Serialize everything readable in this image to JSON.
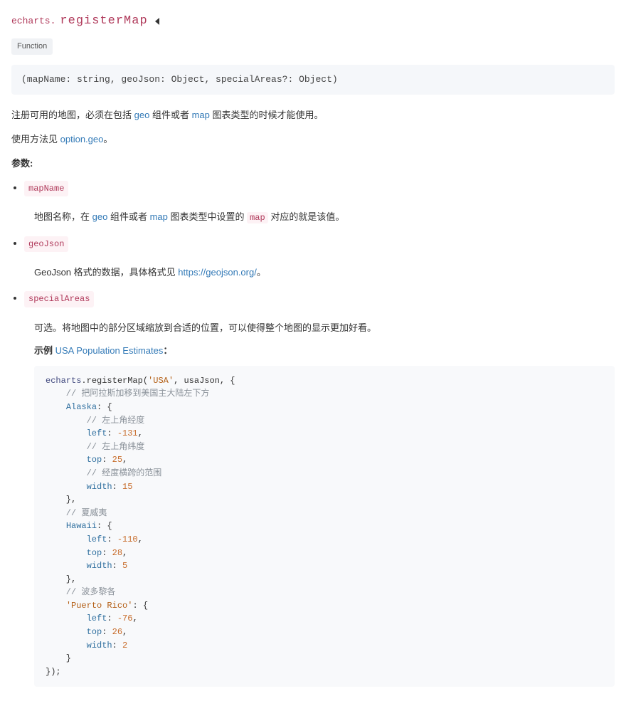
{
  "header": {
    "namespace": "echarts.",
    "methodName": "registerMap",
    "typeTag": "Function"
  },
  "signature": "(mapName: string, geoJson: Object, specialAreas?: Object)",
  "intro": {
    "line1": {
      "pre": "注册可用的地图，必须在包括 ",
      "link1": "geo",
      "mid1": " 组件或者 ",
      "link2": "map",
      "post": " 图表类型的时候才能使用。"
    },
    "line2": {
      "pre": "使用方法见 ",
      "link": "option.geo",
      "post": "。"
    }
  },
  "paramsLabel": "参数:",
  "params": {
    "mapName": {
      "name": "mapName",
      "desc": {
        "pre": "地图名称，在 ",
        "link1": "geo",
        "mid1": " 组件或者 ",
        "link2": "map",
        "mid2": " 图表类型中设置的 ",
        "code": "map",
        "post": " 对应的就是该值。"
      }
    },
    "geoJson": {
      "name": "geoJson",
      "desc": {
        "pre": "GeoJson 格式的数据，具体格式见 ",
        "link": "https://geojson.org/",
        "post": "。"
      }
    },
    "specialAreas": {
      "name": "specialAreas",
      "desc": {
        "text": "可选。将地图中的部分区域缩放到合适的位置，可以使得整个地图的显示更加好看。"
      },
      "exampleLabelPrefix": "示例 ",
      "exampleLink": "USA Population Estimates",
      "exampleLabelSuffix": "："
    }
  },
  "code": {
    "l1a": "echarts",
    "l1b": ".",
    "l1c": "registerMap",
    "l1d": "(",
    "l1e": "'USA'",
    "l1f": ", usaJson, {",
    "l2": "    // 把阿拉斯加移到美国主大陆左下方",
    "l3a": "    ",
    "l3b": "Alaska",
    "l3c": ": {",
    "l4": "        // 左上角经度",
    "l5a": "        ",
    "l5b": "left",
    "l5c": ": ",
    "l5d": "-131",
    "l5e": ",",
    "l6": "        // 左上角纬度",
    "l7a": "        ",
    "l7b": "top",
    "l7c": ": ",
    "l7d": "25",
    "l7e": ",",
    "l8": "        // 经度横跨的范围",
    "l9a": "        ",
    "l9b": "width",
    "l9c": ": ",
    "l9d": "15",
    "l10": "    },",
    "l11": "    // 夏威夷",
    "l12a": "    ",
    "l12b": "Hawaii",
    "l12c": ": {",
    "l13a": "        ",
    "l13b": "left",
    "l13c": ": ",
    "l13d": "-110",
    "l13e": ",",
    "l14a": "        ",
    "l14b": "top",
    "l14c": ": ",
    "l14d": "28",
    "l14e": ",",
    "l15a": "        ",
    "l15b": "width",
    "l15c": ": ",
    "l15d": "5",
    "l16": "    },",
    "l17": "    // 波多黎各",
    "l18a": "    ",
    "l18b": "'Puerto Rico'",
    "l18c": ": {",
    "l19a": "        ",
    "l19b": "left",
    "l19c": ": ",
    "l19d": "-76",
    "l19e": ",",
    "l20a": "        ",
    "l20b": "top",
    "l20c": ": ",
    "l20d": "26",
    "l20e": ",",
    "l21a": "        ",
    "l21b": "width",
    "l21c": ": ",
    "l21d": "2",
    "l22": "    }",
    "l23": "});"
  }
}
